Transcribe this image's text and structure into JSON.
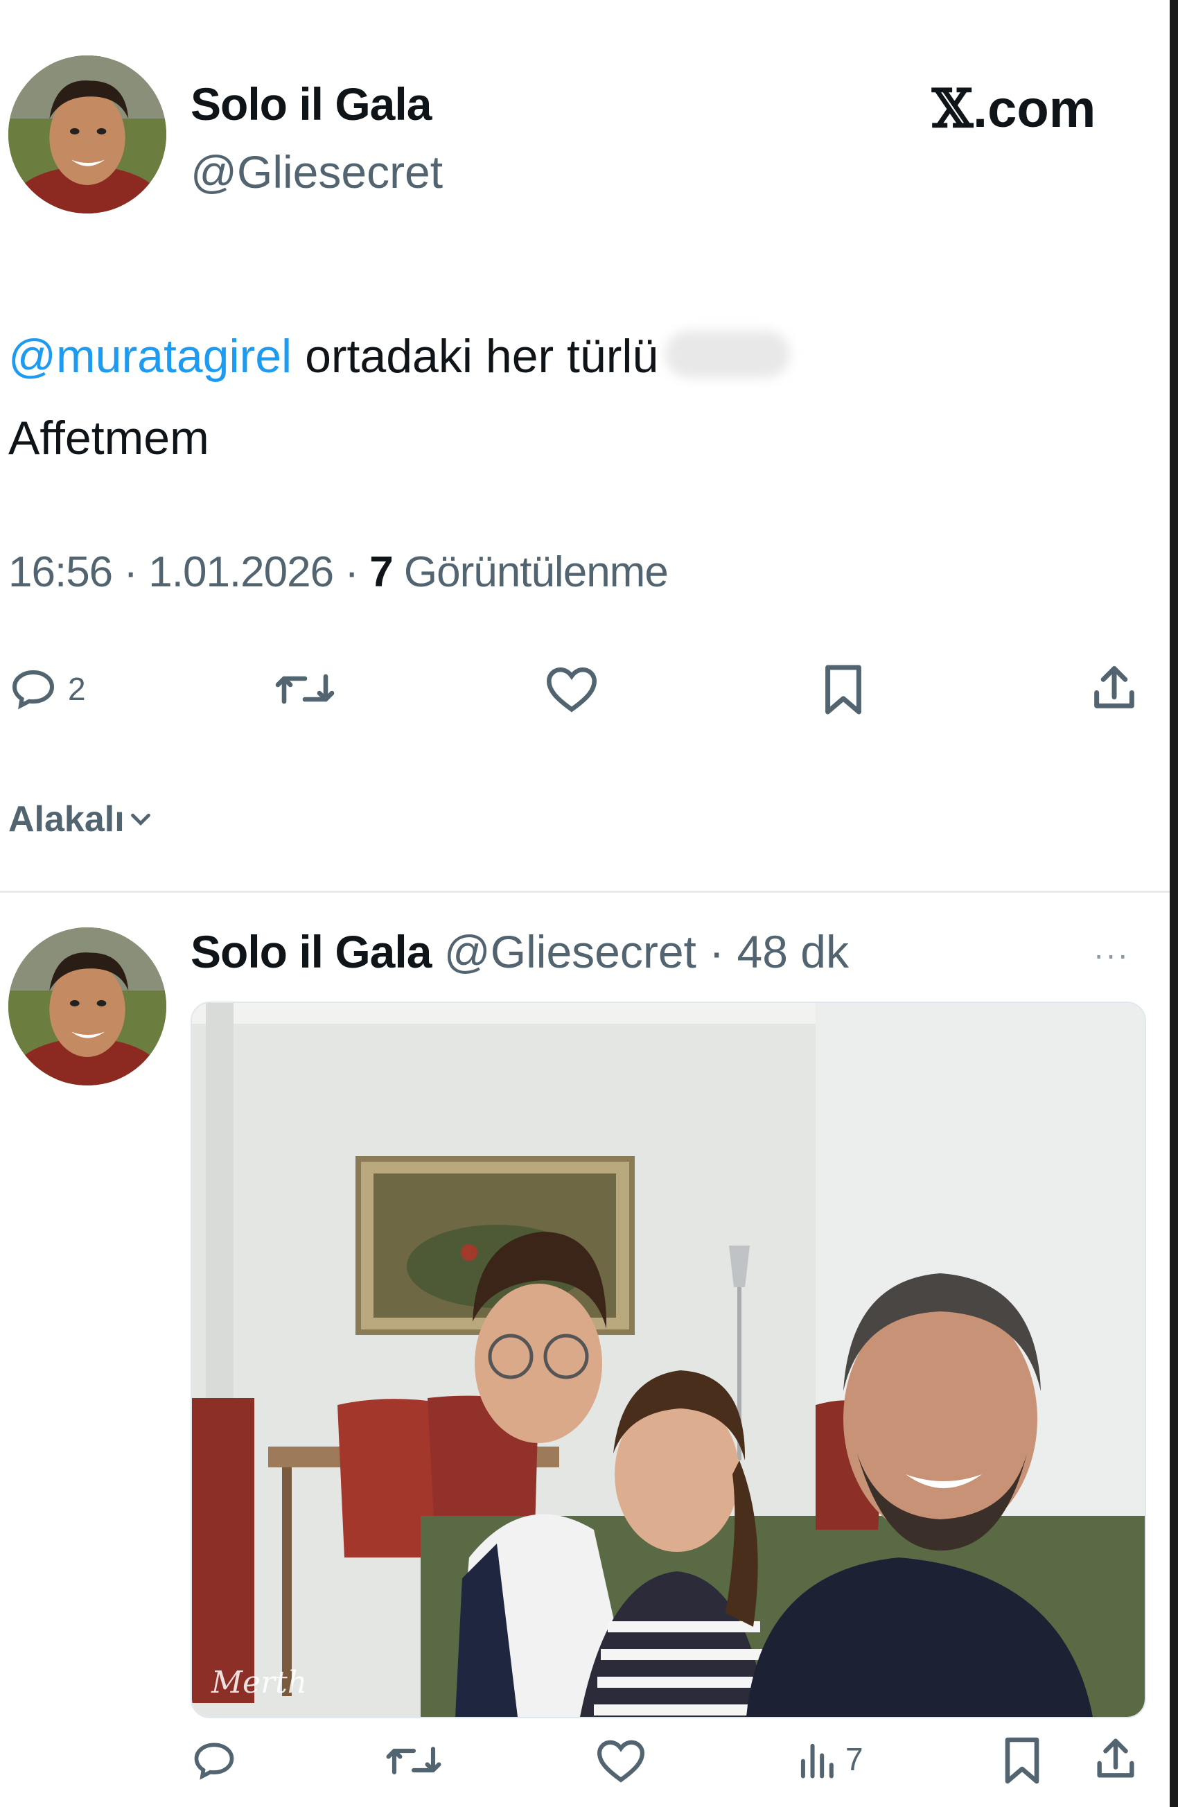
{
  "header": {
    "site_label": "X.com",
    "x_glyph": "𝕏",
    "site_suffix": ".com"
  },
  "main_tweet": {
    "author_name": "Solo il Gala",
    "author_handle": "@Gliesecret",
    "mention": "@muratagirel",
    "text_line1": " ortadaki her türlü",
    "text_line2": "Affetmem",
    "time": "16:56",
    "date": "1.01.2026",
    "sep": " · ",
    "views_count": "7",
    "views_label": " Görüntülenme",
    "actions": {
      "reply_count": "2",
      "icons": [
        "reply-icon",
        "retweet-icon",
        "like-icon",
        "bookmark-icon",
        "share-icon"
      ]
    }
  },
  "sort": {
    "label": "Alakalı"
  },
  "reply_tweet": {
    "author_name": "Solo il Gala",
    "author_handle": "@Gliesecret",
    "sep": " · ",
    "age": "48 dk",
    "more": "···",
    "photo_watermark": "Merth",
    "actions": {
      "views_count": "7",
      "icons": [
        "reply-icon",
        "retweet-icon",
        "like-icon",
        "views-icon",
        "bookmark-icon",
        "share-icon"
      ]
    }
  },
  "colors": {
    "accent": "#1d9bf0",
    "secondary_text": "#536471",
    "primary_text": "#0f1419"
  }
}
